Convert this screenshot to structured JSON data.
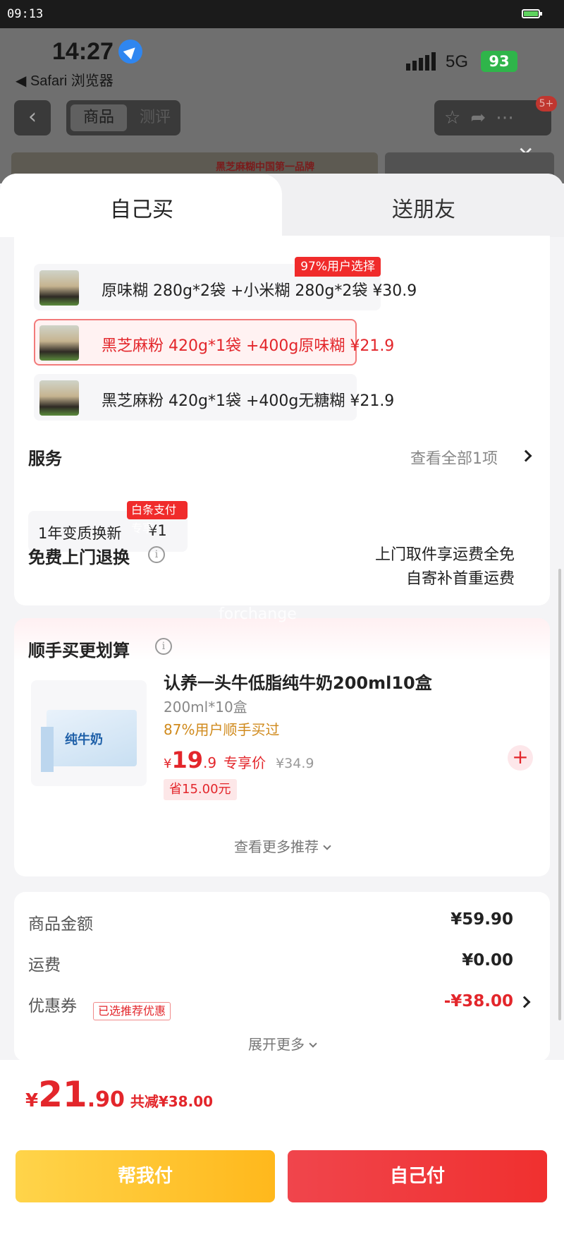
{
  "system": {
    "time": "09:13"
  },
  "background": {
    "time": "14:27",
    "safari": "◀ Safari 浏览器",
    "network": "5G",
    "battery": "93",
    "tabs": [
      "商品",
      "测评"
    ],
    "badge": "5+",
    "banner_text": "黑芝麻糊中国第一品牌"
  },
  "sheet": {
    "tabs": {
      "self": "自己买",
      "gift": "送朋友"
    },
    "options": [
      {
        "text": "原味糊 280g*2袋 +小米糊 280g*2袋  ¥30.9",
        "flag": "97%用户选择",
        "selected": false
      },
      {
        "text": "黑芝麻粉 420g*1袋 +400g原味糊   ¥21.9",
        "selected": true
      },
      {
        "text": "黑芝麻粉 420g*1袋 +400g无糖糊  ¥21.9",
        "selected": false
      }
    ],
    "service": {
      "title": "服务",
      "link": "查看全部1项",
      "item_name": "1年变质换新",
      "item_price": "¥1",
      "item_tag": "白条支付专享"
    },
    "return": {
      "title": "免费上门退换",
      "line1": "上门取件享运费全免",
      "line2": "自寄补首重运费"
    }
  },
  "addon": {
    "watermark": "forchange",
    "title": "顺手买更划算",
    "product": {
      "name": "认养一头牛低脂纯牛奶200ml10盒",
      "spec": "200ml*10盒",
      "hot": "87%用户顺手买过",
      "currency": "¥",
      "price_int": "19",
      "price_dec": ".9",
      "price_label": "专享价",
      "old_price": "¥34.9",
      "save": "省15.00元",
      "box_text": "纯牛奶"
    },
    "more": "查看更多推荐"
  },
  "summary": {
    "goods_label": "商品金额",
    "goods_value": "¥59.90",
    "shipping_label": "运费",
    "shipping_value": "¥0.00",
    "coupon_label": "优惠券",
    "coupon_tag": "已选推荐优惠",
    "coupon_value": "-¥38.00",
    "expand": "展开更多"
  },
  "checkout": {
    "currency": "¥",
    "total_int": "21",
    "total_dec": ".90",
    "discount": "共减¥38.00",
    "help_pay": "帮我付",
    "self_pay": "自己付"
  },
  "colors": {
    "accent": "#e3262b",
    "help_button": "#ffc62e",
    "pay_button": "#f03a3e"
  }
}
